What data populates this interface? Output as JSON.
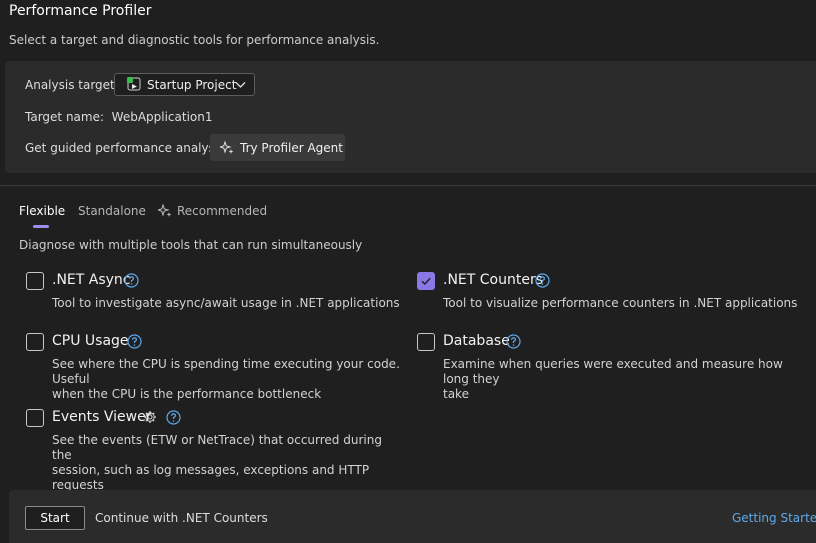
{
  "header": {
    "title": "Performance Profiler",
    "subtitle": "Select a target and diagnostic tools for performance analysis."
  },
  "target": {
    "analysis_label": "Analysis target:",
    "selected": "Startup Project",
    "name_label": "Target name:",
    "name_value": "WebApplication1",
    "guided_label": "Get guided performance analysis:",
    "agent_button": "Try Profiler Agent"
  },
  "tabs": [
    {
      "label": "Flexible",
      "active": true
    },
    {
      "label": "Standalone",
      "active": false
    },
    {
      "label": "Recommended",
      "active": false,
      "icon": "sparkle-icon"
    }
  ],
  "tab_description": "Diagnose with multiple tools that can run simultaneously",
  "tools": [
    {
      "name": ".NET Async",
      "checked": false,
      "has_settings": false,
      "description_lines": [
        "Tool to investigate async/await usage in .NET applications"
      ]
    },
    {
      "name": ".NET Counters",
      "checked": true,
      "has_settings": false,
      "description_lines": [
        "Tool to visualize performance counters in .NET applications"
      ]
    },
    {
      "name": "CPU Usage",
      "checked": false,
      "has_settings": false,
      "description_lines": [
        "See where the CPU is spending time executing your code. Useful",
        "when the CPU is the performance bottleneck"
      ]
    },
    {
      "name": "Database",
      "checked": false,
      "has_settings": false,
      "description_lines": [
        "Examine when queries were executed and measure how long they",
        "take"
      ]
    },
    {
      "name": "Events Viewer",
      "checked": false,
      "has_settings": true,
      "description_lines": [
        "See the events (ETW or NetTrace) that occurred during the",
        "session, such as log messages, exceptions and HTTP requests"
      ]
    }
  ],
  "footer": {
    "start_button": "Start",
    "continue_text": "Continue with .NET Counters",
    "link": "Getting Started"
  },
  "colors": {
    "background": "#1f1f1f",
    "panel": "#2b2b2b",
    "accent": "#8a78e6",
    "help_icon": "#5fa9ea",
    "link": "#5fa9ea"
  }
}
